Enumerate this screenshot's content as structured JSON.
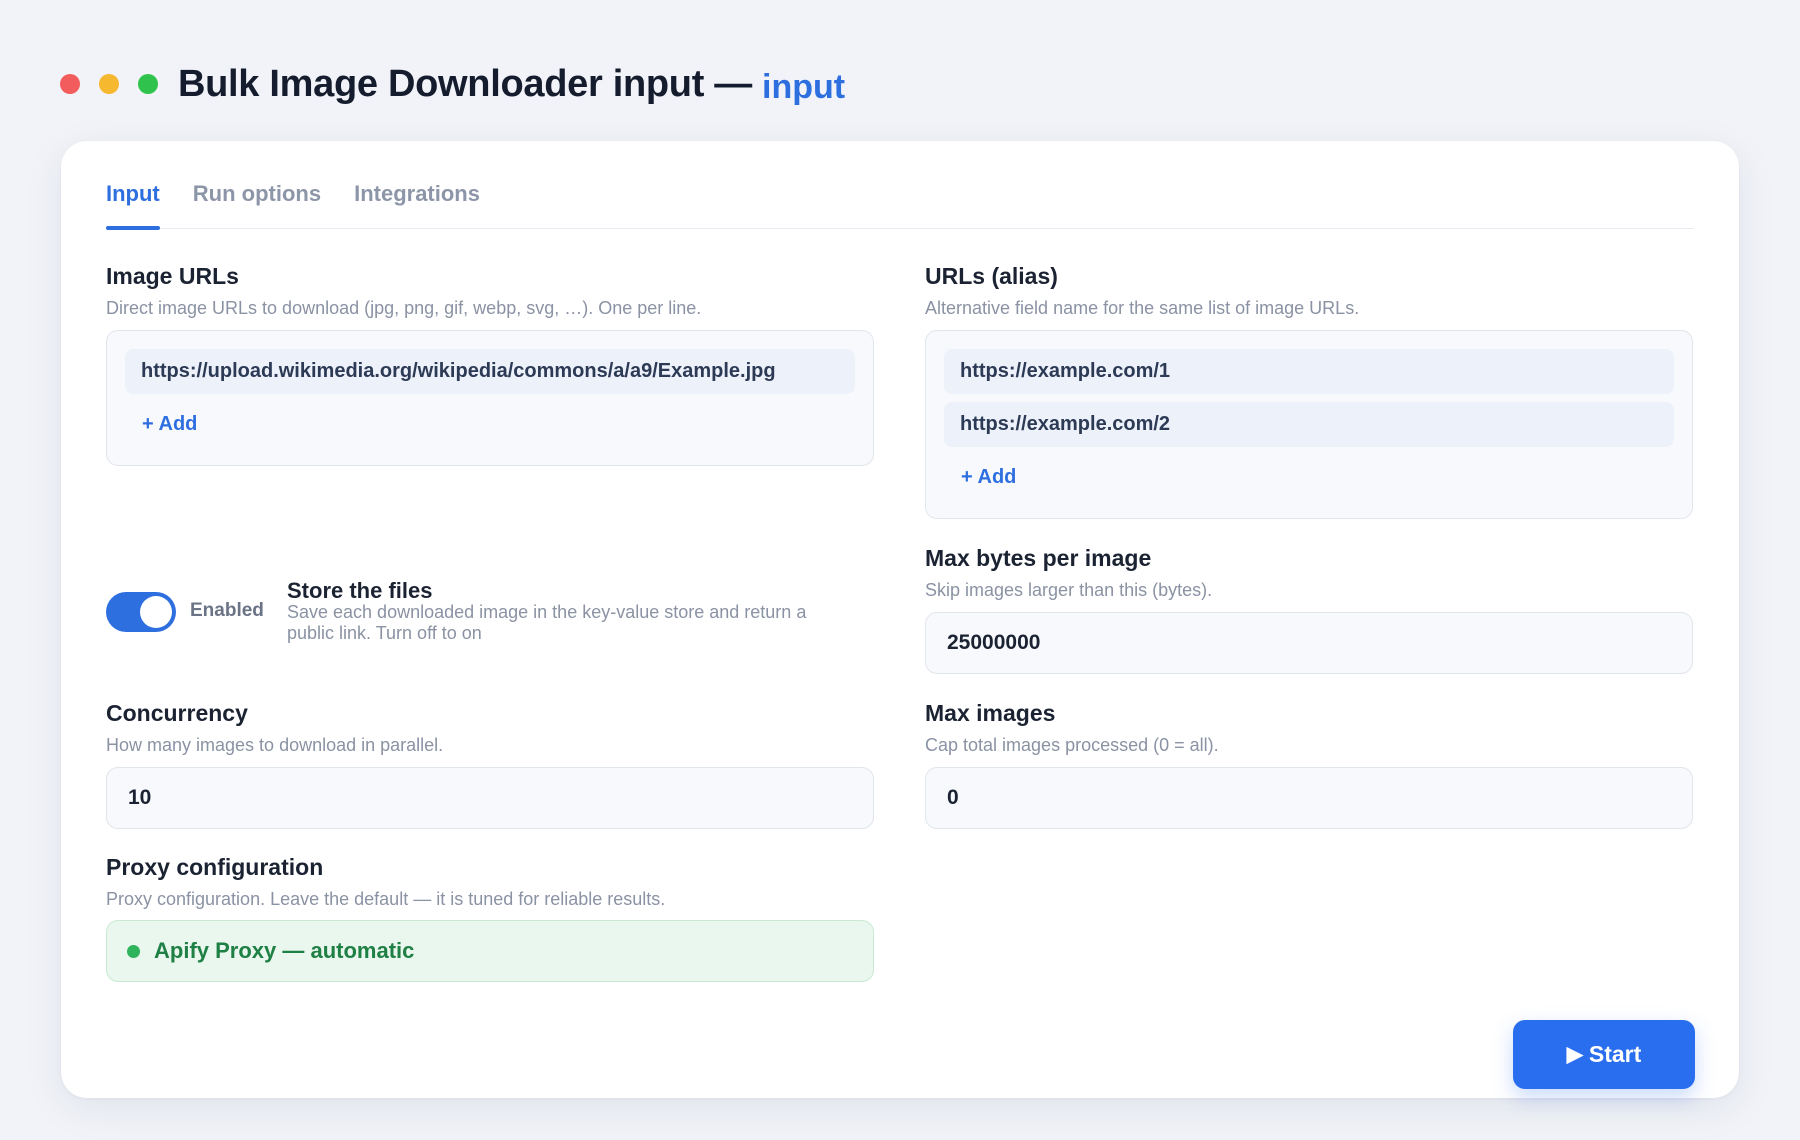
{
  "window": {
    "title": "Bulk Image Downloader input — ",
    "subtitle": "input"
  },
  "tabs": [
    {
      "label": "Input",
      "active": true
    },
    {
      "label": "Run options",
      "active": false
    },
    {
      "label": "Integrations",
      "active": false
    }
  ],
  "image_urls": {
    "label": "Image URLs",
    "help": "Direct image URLs to download (jpg, png, gif, webp, svg, …). One per line.",
    "items": [
      "https://upload.wikimedia.org/wikipedia/commons/a/a9/Example.jpg"
    ],
    "add_label": "+ Add"
  },
  "urls_alias": {
    "label": "URLs (alias)",
    "help": "Alternative field name for the same list of image URLs.",
    "items": [
      "https://example.com/1",
      "https://example.com/2"
    ],
    "add_label": "+ Add"
  },
  "store_files": {
    "state_label": "Enabled",
    "enabled": true,
    "title": "Store the files",
    "help": "Save each downloaded image in the key-value store and return a public link. Turn off to on"
  },
  "max_bytes": {
    "label": "Max bytes per image",
    "help": "Skip images larger than this (bytes).",
    "value": "25000000"
  },
  "concurrency": {
    "label": "Concurrency",
    "help": "How many images to download in parallel.",
    "value": "10"
  },
  "max_images": {
    "label": "Max images",
    "help": "Cap total images processed (0 = all).",
    "value": "0"
  },
  "proxy": {
    "label": "Proxy configuration",
    "help": "Proxy configuration. Leave the default — it is tuned for reliable results.",
    "value": "Apify Proxy — automatic"
  },
  "start_button": {
    "icon": "play-icon",
    "label": "Start"
  },
  "colors": {
    "accent": "#2e6fe0",
    "proxy_green": "#1f8045",
    "background": "#f1f3f8"
  }
}
